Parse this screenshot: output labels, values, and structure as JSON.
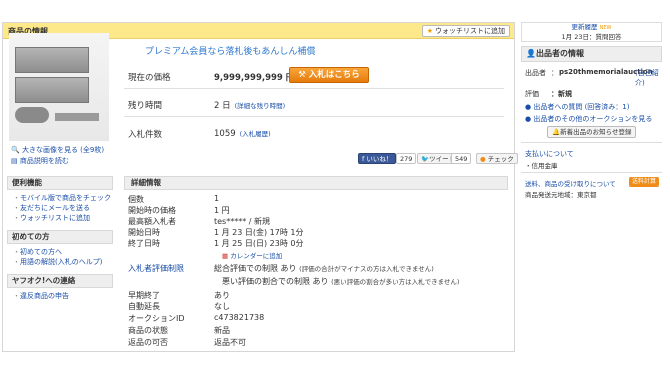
{
  "header": {
    "title": "商品の情報",
    "watch_label": "ウォッチリストに追加"
  },
  "main": {
    "promo": "プレミアム会員なら落札後もあんしん補償",
    "rows": [
      {
        "label": "現在の価格",
        "value": "9,999,999,999 円"
      },
      {
        "label": "残り時間",
        "value": "2 日",
        "link": "(詳細な残り時間)"
      },
      {
        "label": "入札件数",
        "value": "1059",
        "link": "(入札履歴)"
      }
    ],
    "bid_button": "入札はこちら",
    "image_links": [
      "大きな画像を見る (全9枚)",
      "商品説明を読む"
    ],
    "social": {
      "like": "いいね！",
      "like_count": "279",
      "tweet": "ツイート",
      "tweet_count": "549",
      "check": "チェック"
    }
  },
  "left_nav": [
    {
      "title": "便利機能",
      "items": [
        "モバイル版で商品をチェック",
        "友だちにメールを送る",
        "ウォッチリストに追加"
      ]
    },
    {
      "title": "初めての方",
      "items": [
        "初めての方へ",
        "用語の解説(入札のヘルプ)"
      ]
    },
    {
      "title": "ヤフオク!への連絡",
      "items": [
        "違反商品の申告"
      ]
    }
  ],
  "details": {
    "title": "詳細情報",
    "rows": [
      {
        "k": "個数",
        "v": "1"
      },
      {
        "k": "開始時の価格",
        "v": "1 円"
      },
      {
        "k": "最高額入札者",
        "v": "tes***** / 新規"
      },
      {
        "k": "開始日時",
        "v": "1 月 23 日(金) 17時 1分"
      },
      {
        "k": "終了日時",
        "v": "1 月 25 日(日) 23時 0分"
      },
      {
        "k": "",
        "v": "カレンダーに追加"
      },
      {
        "k": "入札者評価制限",
        "v": "総合評価での制限 あり",
        "note": "(評価の合計がマイナスの方は入札できません)"
      },
      {
        "k": "",
        "v": "悪い評価の割合での制限 あり",
        "note": "(悪い評価の割合が多い方は入札できません)"
      },
      {
        "k": "早期終了",
        "v": "あり"
      },
      {
        "k": "自動延長",
        "v": "なし"
      },
      {
        "k": "オークションID",
        "v": "c473821738"
      },
      {
        "k": "商品の状態",
        "v": "新品"
      },
      {
        "k": "返品の可否",
        "v": "返品不可"
      }
    ]
  },
  "side": {
    "history_label": "更新履歴",
    "new_badge": "NEW",
    "history_date": "1月 23日：質問回答",
    "seller_title": "出品者の情報",
    "seller_label": "出品者",
    "seller_id": "ps20thmemorialauction",
    "self_eval": "(自己紹介)",
    "rating_label": "評価",
    "rating_value": "新規",
    "links": [
      "出品者への質問 (回答済み：1)",
      "出品者のその他のオークションを見る"
    ],
    "reg_button": "新着出品のお知らせ登録",
    "pay_title": "支払いについて",
    "pay_value": "・信用金庫",
    "ship_title": "送料、商品の受け取りについて",
    "ship_button": "送料計算",
    "ship_from": "商品発送元地域：東京都"
  },
  "colors": {
    "header_bg": "#fde88a",
    "bid": "#f08c1a",
    "link": "#1a4ea8"
  }
}
